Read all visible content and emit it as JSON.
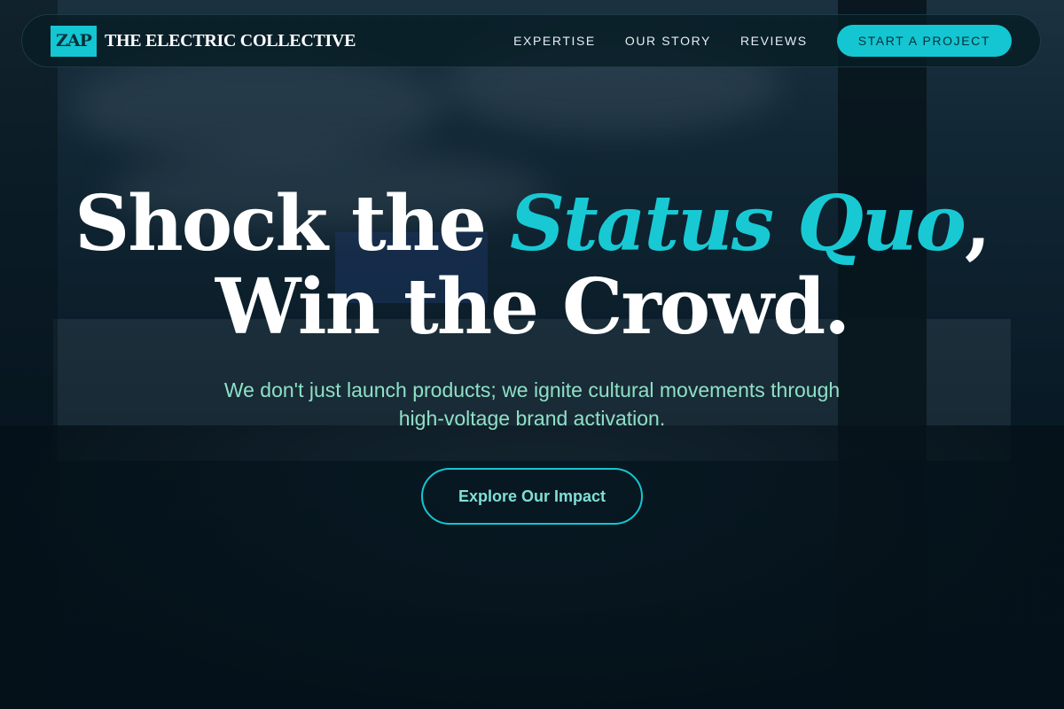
{
  "nav": {
    "brand_mark": "ZAP",
    "brand_name": "THE ELECTRIC COLLECTIVE",
    "links": [
      "EXPERTISE",
      "OUR STORY",
      "REVIEWS"
    ],
    "cta_label": "START A PROJECT"
  },
  "hero": {
    "title_part1": "Shock the ",
    "title_accent": "Status Quo",
    "title_part2": ",",
    "title_line2": "Win the Crowd.",
    "subtitle": "We don't just launch products; we ignite cultural movements through high-voltage brand activation.",
    "button_label": "Explore Our Impact"
  },
  "colors": {
    "accent": "#14c6d2",
    "background": "#071a24",
    "subtitle_text": "#8fe0c6"
  }
}
